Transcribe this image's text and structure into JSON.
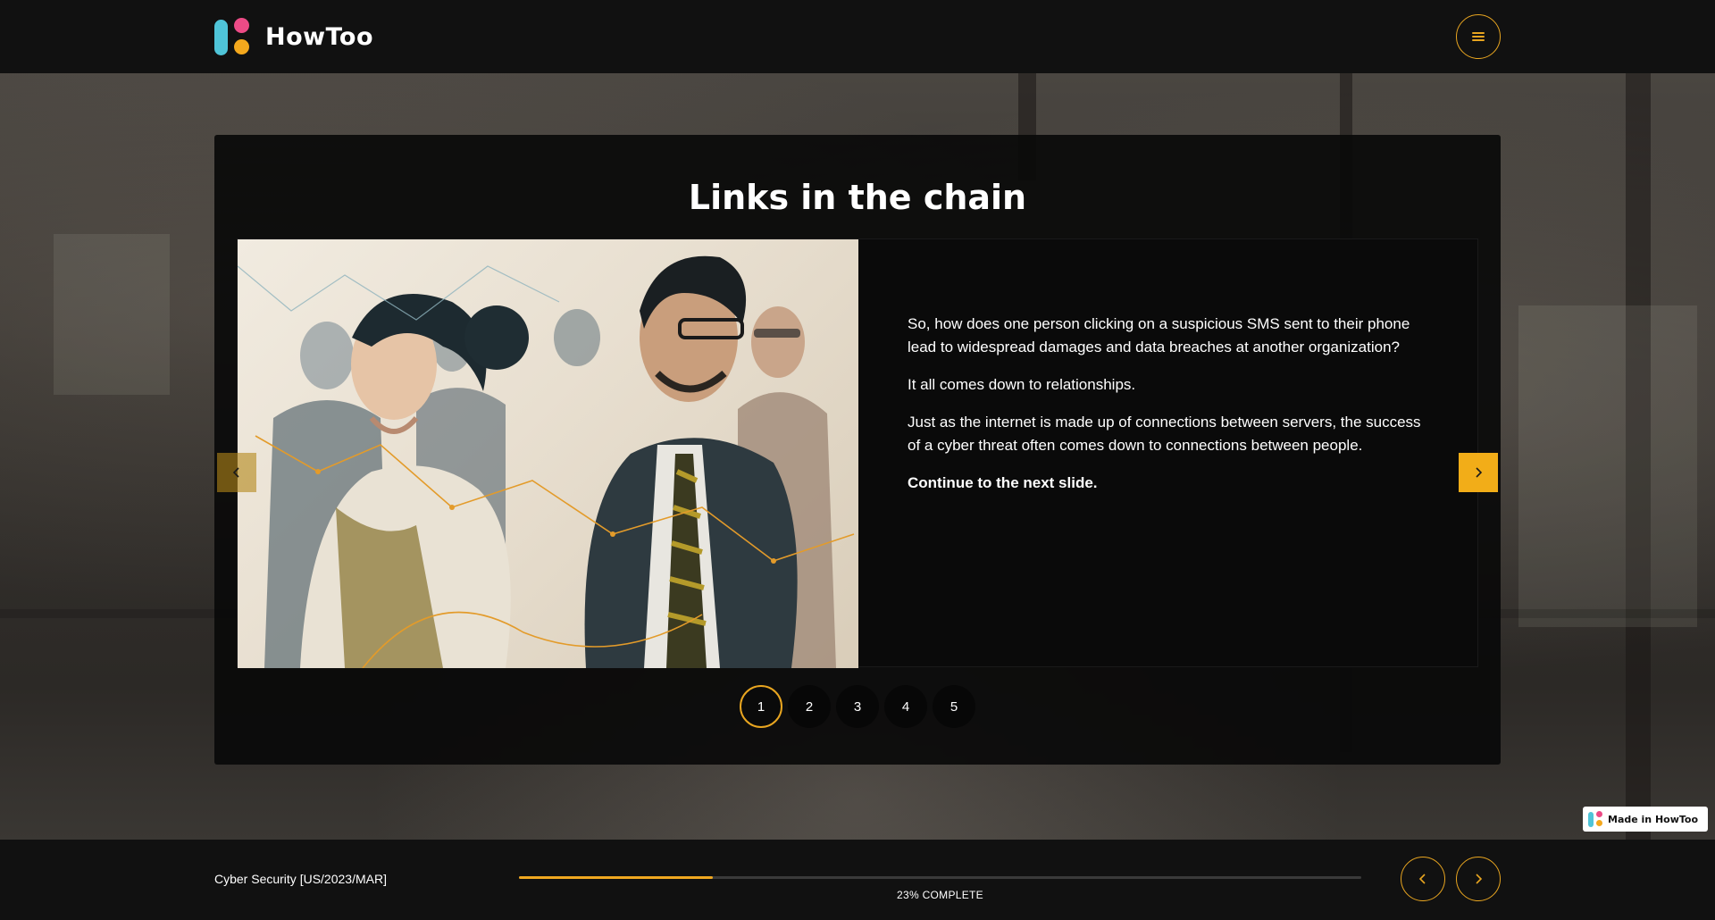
{
  "app": {
    "name": "HowToo",
    "brand_colors": {
      "cyan": "#4fc4d8",
      "pink": "#ec4b86",
      "amber": "#f4a81d"
    }
  },
  "header": {
    "menu_icon": "hamburger-icon"
  },
  "slide": {
    "title": "Links in the chain",
    "image_alt": "Illustration of business people connected by lines",
    "paragraphs": [
      "So, how does one person clicking on a suspicious SMS sent to their phone lead to widespread damages and data breaches at another organization?",
      "It all comes down to relationships.",
      "Just as the internet is made up of connections between servers, the success of a cyber threat often comes down to connections between people."
    ],
    "cta": "Continue to the next slide.",
    "prev_icon": "chevron-left-icon",
    "next_icon": "chevron-right-icon"
  },
  "pager": {
    "pages": [
      "1",
      "2",
      "3",
      "4",
      "5"
    ],
    "active": "1"
  },
  "badge": {
    "label": "Made in HowToo"
  },
  "footer": {
    "course_title": "Cyber Security [US/2023/MAR]",
    "progress_percent": 23,
    "progress_label": "23% COMPLETE",
    "accent": "#f0a820"
  }
}
